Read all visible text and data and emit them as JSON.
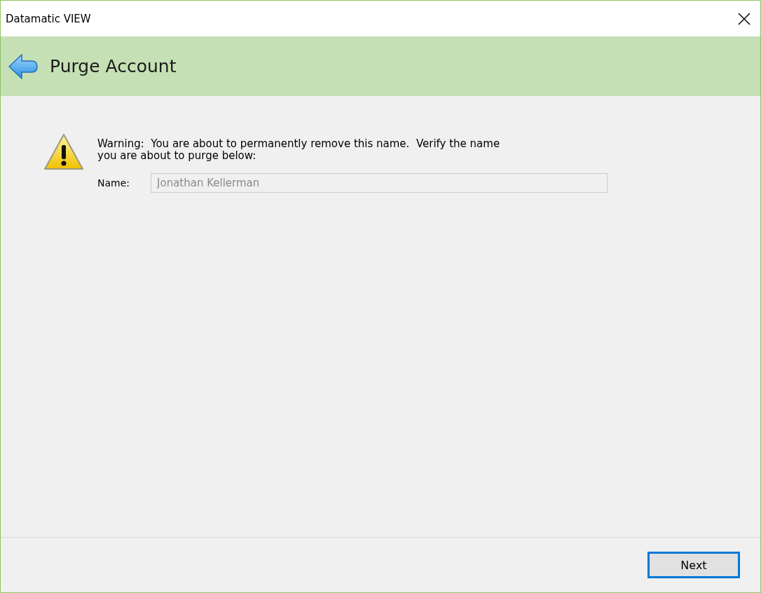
{
  "window": {
    "title": "Datamatic VIEW"
  },
  "header": {
    "title": "Purge Account"
  },
  "warning": {
    "message": "Warning:  You are about to permanently remove this name.  Verify the name\nyou are about to purge below:"
  },
  "name_field": {
    "label": "Name:",
    "value": "Jonathan Kellerman",
    "disabled": true
  },
  "buttons": [
    {
      "label": "Next",
      "focused": true
    }
  ]
}
